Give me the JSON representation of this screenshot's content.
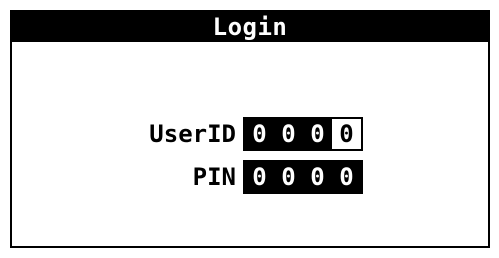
{
  "title": "Login",
  "fields": {
    "userid": {
      "label": "UserID",
      "digits": [
        "0",
        "0",
        "0",
        "0"
      ],
      "active_index": 3
    },
    "pin": {
      "label": "PIN",
      "digits": [
        "0",
        "0",
        "0",
        "0"
      ]
    }
  },
  "colors": {
    "foreground": "#000000",
    "background": "#ffffff"
  }
}
